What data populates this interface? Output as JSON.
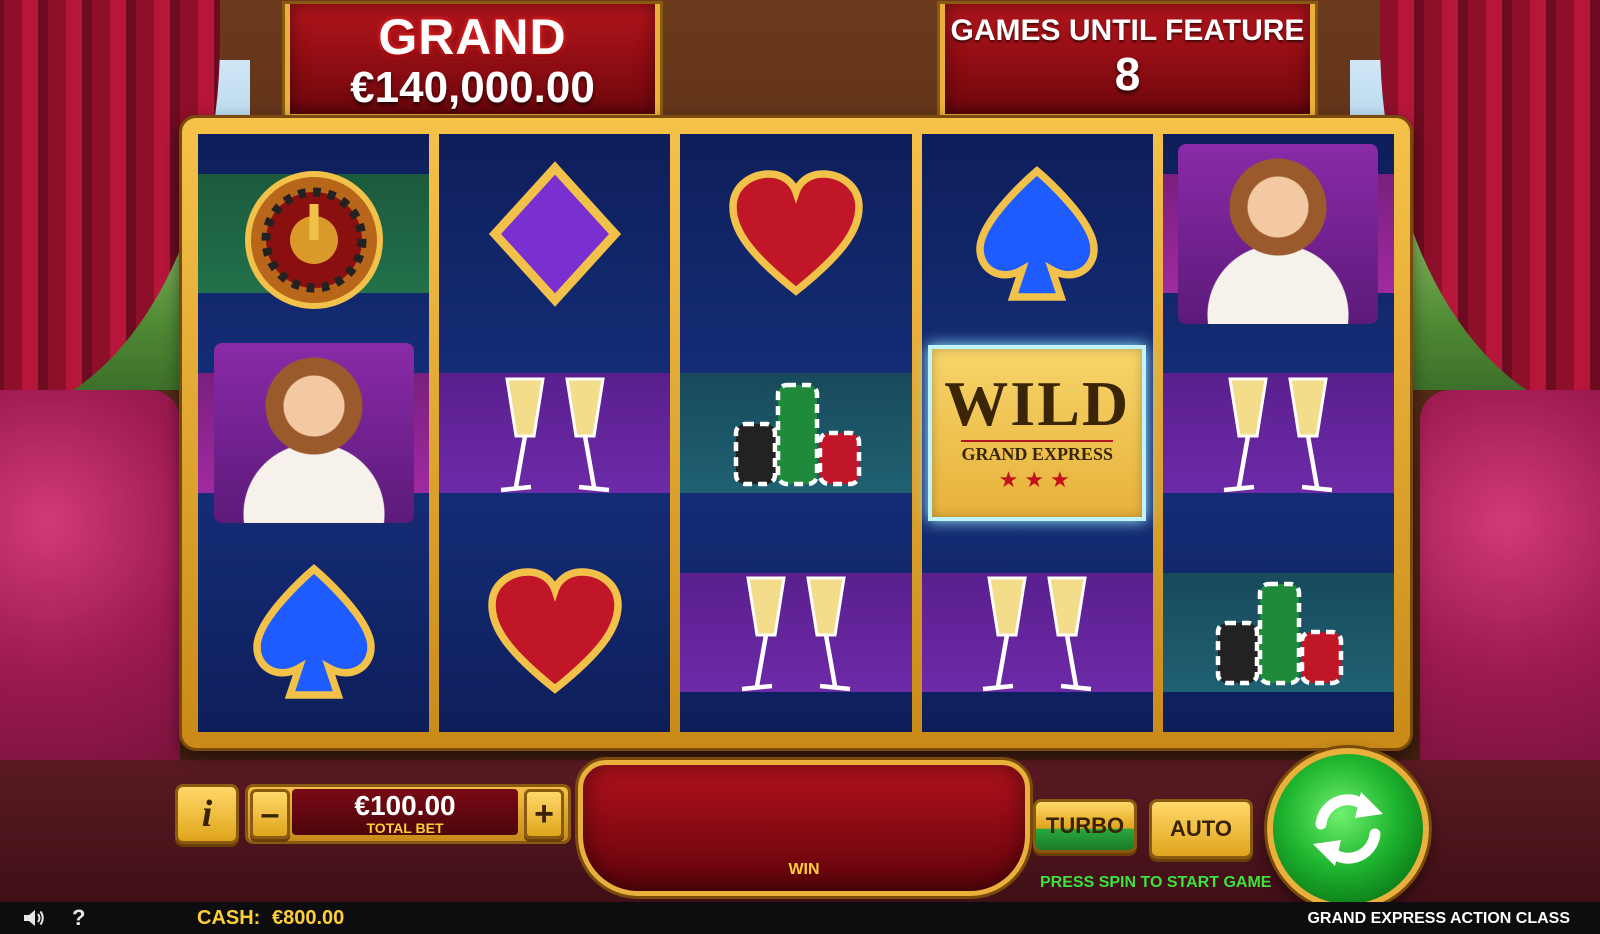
{
  "jackpot": {
    "label": "GRAND",
    "value": "€140,000.00"
  },
  "feature": {
    "label": "GAMES UNTIL FEATURE",
    "count": "8"
  },
  "reels": [
    [
      "roulette",
      "lady",
      "spade"
    ],
    [
      "diamond",
      "champagne",
      "heart"
    ],
    [
      "heart",
      "chips",
      "champagne"
    ],
    [
      "spade",
      "wild",
      "champagne"
    ],
    [
      "lady",
      "champagne",
      "chips"
    ]
  ],
  "wild": {
    "title": "WILD",
    "subtitle": "GRAND EXPRESS",
    "stars": "★★★"
  },
  "controls": {
    "info_label": "i",
    "minus_label": "–",
    "plus_label": "+",
    "bet_value": "€100.00",
    "bet_label": "TOTAL BET",
    "win_label": "WIN",
    "turbo_label": "TURBO",
    "auto_label": "AUTO",
    "hint": "PRESS SPIN TO START GAME"
  },
  "status": {
    "help_label": "?",
    "cash_label": "CASH:",
    "cash_value": "€800.00",
    "game_name": "GRAND EXPRESS ACTION CLASS"
  },
  "colors": {
    "gold": "#e9b03c",
    "red": "#b3151c",
    "reel_blue": "#16307e",
    "spin_green": "#1fb52f"
  }
}
